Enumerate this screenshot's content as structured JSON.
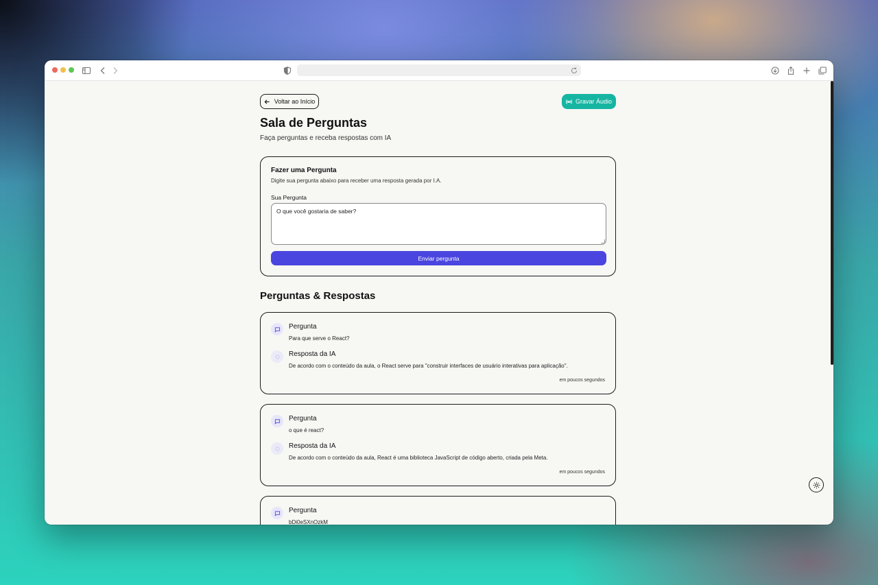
{
  "colors": {
    "primary": "#4b45e0",
    "teal": "#16b5a2",
    "page_bg": "#f7f7f4",
    "close_dot": "#ec6a5e",
    "minimize_dot": "#f4bf4f",
    "zoom_dot": "#61c554"
  },
  "browser": {
    "url": "",
    "icons": [
      "sidebar-icon",
      "back-icon",
      "forward-icon",
      "privacy-shield-icon",
      "reload-icon",
      "download-icon",
      "share-icon",
      "new-tab-icon",
      "tabs-overview-icon"
    ]
  },
  "header": {
    "back_label": "Voltar ao Início",
    "audio_label": "Gravar Áudio"
  },
  "page": {
    "title": "Sala de Perguntas",
    "subtitle": "Faça perguntas e receba respostas com IA"
  },
  "ask": {
    "title": "Fazer uma Pergunta",
    "description": "Digite sua pergunta abaixo para receber uma resposta gerada por I.A.",
    "label": "Sua Pergunta",
    "placeholder": "O que você gostaria de saber?",
    "submit_label": "Enviar pergunta"
  },
  "qa_section": {
    "title": "Perguntas & Respostas",
    "items": [
      {
        "question_heading": "Pergunta",
        "question": "Para que serve o React?",
        "answer_heading": "Resposta da IA",
        "answer": "De acordo com o conteúdo da aula, o React serve para \"construir interfaces de usuário interativas para aplicação\".",
        "time": "em poucos segundos"
      },
      {
        "question_heading": "Pergunta",
        "question": "o que é react?",
        "answer_heading": "Resposta da IA",
        "answer": "De acordo com o conteúdo da aula, React é uma biblioteca JavaScript de código aberto, criada pela Meta.",
        "time": "em poucos segundos"
      },
      {
        "question_heading": "Pergunta",
        "question": "bDi0eSXnOzkM"
      }
    ]
  },
  "theme_toggle_icon": "sun-icon"
}
